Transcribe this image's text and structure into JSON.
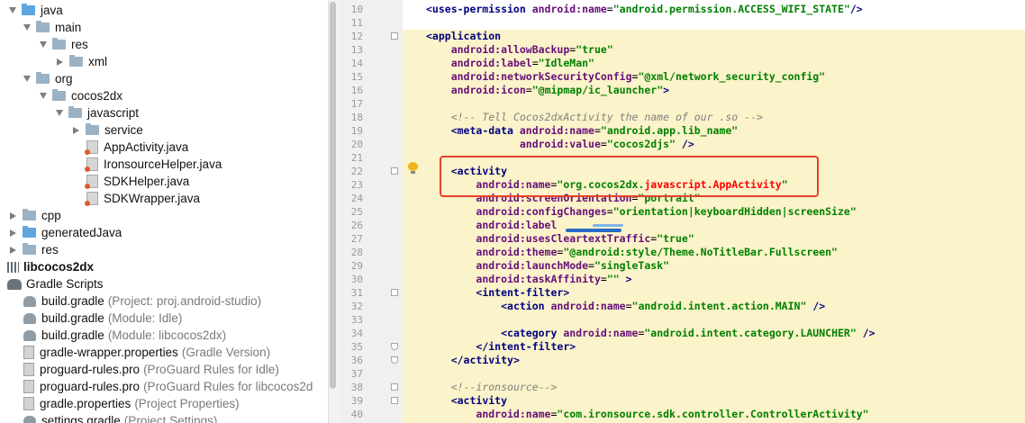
{
  "project_tree": {
    "items": [
      {
        "label": "java",
        "icon": "folder-icon",
        "arrow": "down"
      },
      {
        "label": "main",
        "icon": "folder-icon",
        "arrow": "down"
      },
      {
        "label": "res",
        "icon": "folder-icon",
        "arrow": "down"
      },
      {
        "label": "xml",
        "icon": "folder-icon",
        "arrow": "right"
      },
      {
        "label": "org",
        "icon": "folder-icon",
        "arrow": "down"
      },
      {
        "label": "cocos2dx",
        "icon": "folder-icon",
        "arrow": "down"
      },
      {
        "label": "javascript",
        "icon": "folder-icon",
        "arrow": "down"
      },
      {
        "label": "service",
        "icon": "folder-icon",
        "arrow": "right"
      },
      {
        "label": "AppActivity.java",
        "icon": "java-file-icon"
      },
      {
        "label": "IronsourceHelper.java",
        "icon": "java-file-icon"
      },
      {
        "label": "SDKHelper.java",
        "icon": "java-file-icon"
      },
      {
        "label": "SDKWrapper.java",
        "icon": "java-file-icon"
      },
      {
        "label": "cpp",
        "icon": "folder-icon",
        "arrow": "right"
      },
      {
        "label": "generatedJava",
        "icon": "folder-icon",
        "arrow": "right"
      },
      {
        "label": "res",
        "icon": "folder-icon",
        "arrow": "right"
      },
      {
        "label": "libcocos2dx",
        "icon": "library-icon"
      },
      {
        "label": "Gradle Scripts",
        "icon": "gradle-scripts-icon"
      },
      {
        "label": "build.gradle",
        "note": "(Project: proj.android-studio)",
        "icon": "gradle-icon"
      },
      {
        "label": "build.gradle",
        "note": "(Module: Idle)",
        "icon": "gradle-icon"
      },
      {
        "label": "build.gradle",
        "note": "(Module: libcocos2dx)",
        "icon": "gradle-icon"
      },
      {
        "label": "gradle-wrapper.properties",
        "note": "(Gradle Version)",
        "icon": "properties-file-icon"
      },
      {
        "label": "proguard-rules.pro",
        "note": "(ProGuard Rules for Idle)",
        "icon": "properties-file-icon"
      },
      {
        "label": "proguard-rules.pro",
        "note": "(ProGuard Rules for libcocos2d",
        "icon": "properties-file-icon"
      },
      {
        "label": "gradle.properties",
        "note": "(Project Properties)",
        "icon": "properties-file-icon"
      },
      {
        "label": "settings.gradle",
        "note": "(Project Settings)",
        "icon": "gradle-icon"
      }
    ]
  },
  "editor": {
    "line_numbers": [
      "10",
      "11",
      "12",
      "13",
      "14",
      "15",
      "16",
      "17",
      "18",
      "19",
      "20",
      "21",
      "22",
      "23",
      "24",
      "25",
      "26",
      "27",
      "28",
      "29",
      "30",
      "31",
      "32",
      "33",
      "34",
      "35",
      "36",
      "37",
      "38",
      "39",
      "40"
    ],
    "lines": [
      [
        [
          "t",
          "<uses-permission "
        ],
        [
          "an",
          "android:name"
        ],
        [
          "",
          "="
        ],
        [
          "av",
          "\"android.permission.ACCESS_WIFI_STATE\""
        ],
        [
          "t",
          "/>"
        ]
      ],
      [],
      [
        [
          "t",
          "<application"
        ]
      ],
      [
        [
          "",
          "    "
        ],
        [
          "an",
          "android:allowBackup"
        ],
        [
          "",
          "="
        ],
        [
          "av",
          "\"true\""
        ]
      ],
      [
        [
          "",
          "    "
        ],
        [
          "an",
          "android:label"
        ],
        [
          "",
          "="
        ],
        [
          "av",
          "\"IdleMan\""
        ]
      ],
      [
        [
          "",
          "    "
        ],
        [
          "an",
          "android:networkSecurityConfig"
        ],
        [
          "",
          "="
        ],
        [
          "av",
          "\"@xml/network_security_config\""
        ]
      ],
      [
        [
          "",
          "    "
        ],
        [
          "an",
          "android:icon"
        ],
        [
          "",
          "="
        ],
        [
          "av",
          "\"@mipmap/ic_launcher\""
        ],
        [
          "t",
          ">"
        ]
      ],
      [],
      [
        [
          "",
          "    "
        ],
        [
          "cm",
          "<!-- Tell Cocos2dxActivity the name of our .so -->"
        ]
      ],
      [
        [
          "",
          "    "
        ],
        [
          "t",
          "<meta-data "
        ],
        [
          "an",
          "android:name"
        ],
        [
          "",
          "="
        ],
        [
          "av",
          "\"android.app.lib_name\""
        ]
      ],
      [
        [
          "",
          "               "
        ],
        [
          "an",
          "android:value"
        ],
        [
          "",
          "="
        ],
        [
          "av",
          "\"cocos2djs\""
        ],
        [
          "t",
          " />"
        ]
      ],
      [],
      [
        [
          "",
          "    "
        ],
        [
          "t",
          "<activity"
        ]
      ],
      [
        [
          "",
          "        "
        ],
        [
          "an",
          "android:name"
        ],
        [
          "",
          "="
        ],
        [
          "av",
          "\"org.cocos2dx."
        ],
        [
          "ak",
          "javascript.AppActivity"
        ],
        [
          "av",
          "\""
        ]
      ],
      [
        [
          "",
          "        "
        ],
        [
          "an",
          "android:screenOrientation"
        ],
        [
          "",
          "="
        ],
        [
          "av",
          "\"portrait\""
        ]
      ],
      [
        [
          "",
          "        "
        ],
        [
          "an",
          "android:configChanges"
        ],
        [
          "",
          "="
        ],
        [
          "av",
          "\"orientation|keyboardHidden|screenSize\""
        ]
      ],
      [
        [
          "",
          "        "
        ],
        [
          "an",
          "android:label"
        ]
      ],
      [
        [
          "",
          "        "
        ],
        [
          "an",
          "android:usesCleartextTraffic"
        ],
        [
          "",
          "="
        ],
        [
          "av",
          "\"true\""
        ]
      ],
      [
        [
          "",
          "        "
        ],
        [
          "an",
          "android:theme"
        ],
        [
          "",
          "="
        ],
        [
          "av",
          "\"@android:style/Theme.NoTitleBar.Fullscreen\""
        ]
      ],
      [
        [
          "",
          "        "
        ],
        [
          "an",
          "android:launchMode"
        ],
        [
          "",
          "="
        ],
        [
          "av",
          "\"singleTask\""
        ]
      ],
      [
        [
          "",
          "        "
        ],
        [
          "an",
          "android:taskAffinity"
        ],
        [
          "",
          "="
        ],
        [
          "av",
          "\"\""
        ],
        [
          "t",
          " >"
        ]
      ],
      [
        [
          "",
          "        "
        ],
        [
          "t",
          "<intent-filter>"
        ]
      ],
      [
        [
          "",
          "            "
        ],
        [
          "t",
          "<action "
        ],
        [
          "an",
          "android:name"
        ],
        [
          "",
          "="
        ],
        [
          "av",
          "\"android.intent.action.MAIN\""
        ],
        [
          "t",
          " />"
        ]
      ],
      [],
      [
        [
          "",
          "            "
        ],
        [
          "t",
          "<category "
        ],
        [
          "an",
          "android:name"
        ],
        [
          "",
          "="
        ],
        [
          "av",
          "\"android.intent.category.LAUNCHER\""
        ],
        [
          "t",
          " />"
        ]
      ],
      [
        [
          "",
          "        "
        ],
        [
          "t",
          "</intent-filter>"
        ]
      ],
      [
        [
          "",
          "    "
        ],
        [
          "t",
          "</activity>"
        ]
      ],
      [],
      [
        [
          "",
          "    "
        ],
        [
          "cm",
          "<!--ironsource-->"
        ]
      ],
      [
        [
          "",
          "    "
        ],
        [
          "t",
          "<activity"
        ]
      ],
      [
        [
          "",
          "        "
        ],
        [
          "an",
          "android:name"
        ],
        [
          "",
          "="
        ],
        [
          "av",
          "\"com.ironsource.sdk.controller.ControllerActivity\""
        ]
      ]
    ]
  },
  "colors": {
    "highlight_bg": "#fbf3c9",
    "annotation_box": "#e8412c",
    "tag": "#000080",
    "attribute": "#660e7a",
    "string": "#008000",
    "comment": "#808080"
  },
  "icons": {
    "intention_bulb": "lightbulb-icon"
  }
}
